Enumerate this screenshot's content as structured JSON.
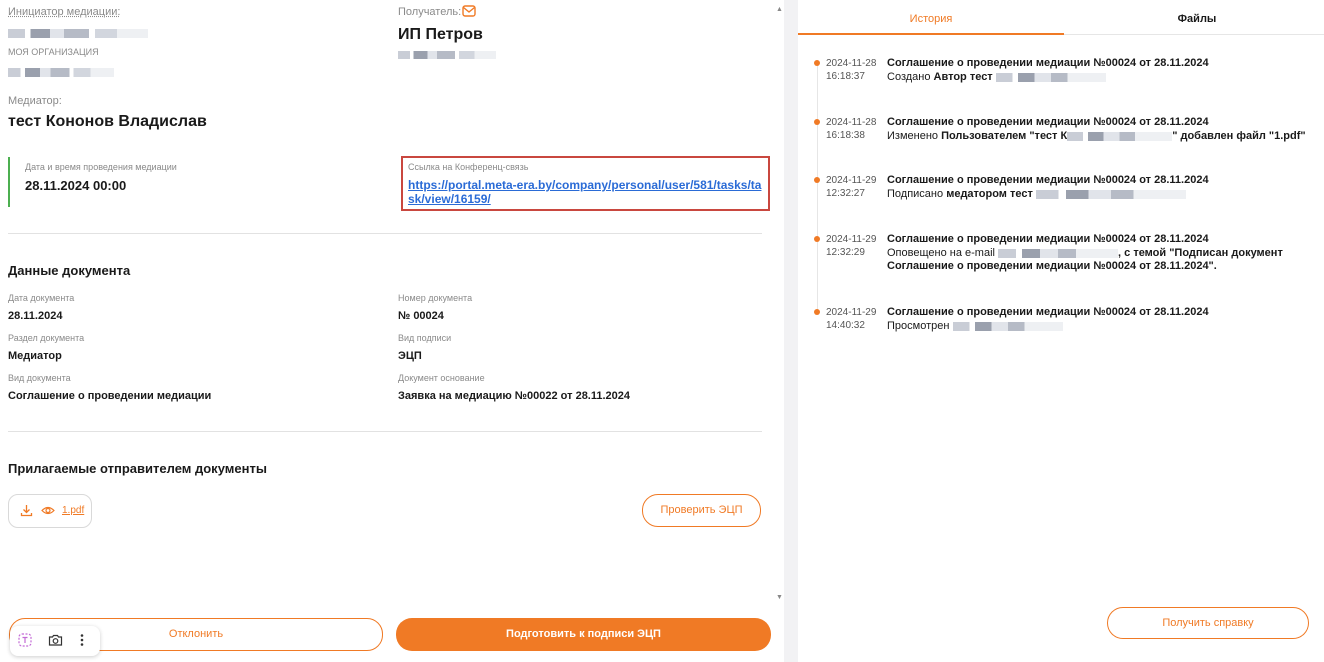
{
  "left": {
    "initiator_label": "Инициатор медиации:",
    "org_label": "МОЯ ОРГАНИЗАЦИЯ",
    "recipient_label": "Получатель:",
    "recipient_name": "ИП Петров",
    "mediator_label": "Медиатор:",
    "mediator_name": "тест Кононов Владислав",
    "datetime_label": "Дата и время проведения медиации",
    "datetime_value": "28.11.2024 00:00",
    "conf_label": "Ссылка на Конференц-связь",
    "conf_link": "https://portal.meta-era.by/company/personal/user/581/tasks/task/view/16159/",
    "doc_section_title": "Данные документа",
    "fields": {
      "doc_date_label": "Дата документа",
      "doc_date_value": "28.11.2024",
      "doc_number_label": "Номер документа",
      "doc_number_value": "№ 00024",
      "doc_section_label": "Раздел документа",
      "doc_section_value": "Медиатор",
      "sign_type_label": "Вид подписи",
      "sign_type_value": "ЭЦП",
      "doc_type_label": "Вид документа",
      "doc_type_value": "Соглашение о проведении медиации",
      "base_doc_label": "Документ основание",
      "base_doc_value": "Заявка на медиацию №00022 от 28.11.2024"
    },
    "attached_title": "Прилагаемые отправителем документы",
    "file_name": "1.pdf",
    "check_ecp_button": "Проверить ЭЦП",
    "reject_button": "Отклонить",
    "prepare_button": "Подготовить к подписи ЭЦП"
  },
  "right": {
    "tab_history": "История",
    "tab_files": "Файлы",
    "history": [
      {
        "date": "2024-11-28",
        "time": "16:18:37",
        "title": "Соглашение о проведении медиации №00024 от 28.11.2024",
        "prefix": "Создано",
        "bold": "Автор тест",
        "suffix": ""
      },
      {
        "date": "2024-11-28",
        "time": "16:18:38",
        "title": "Соглашение о проведении медиации №00024 от 28.11.2024",
        "prefix": "Изменено",
        "bold": "Пользователем \"тест К",
        "suffix": "\" добавлен файл \"1.pdf\""
      },
      {
        "date": "2024-11-29",
        "time": "12:32:27",
        "title": "Соглашение о проведении медиации №00024 от 28.11.2024",
        "prefix": "Подписано",
        "bold": "медатором тест",
        "suffix": ""
      },
      {
        "date": "2024-11-29",
        "time": "12:32:29",
        "title": "Соглашение о проведении медиации №00024 от 28.11.2024",
        "prefix": "Оповещено на e-mail",
        "bold": "",
        "suffix": ", с темой \"Подписан документ Соглашение о проведении медиации №00024 от 28.11.2024\"."
      },
      {
        "date": "2024-11-29",
        "time": "14:40:32",
        "title": "Соглашение о проведении медиации №00024 от 28.11.2024",
        "prefix": "Просмотрен",
        "bold": "",
        "suffix": ""
      }
    ],
    "help_button": "Получить справку"
  },
  "colors": {
    "accent": "#f07a25",
    "link": "#2a6bd6",
    "highlight_border": "#c9473f",
    "green_bar": "#4caf50"
  }
}
